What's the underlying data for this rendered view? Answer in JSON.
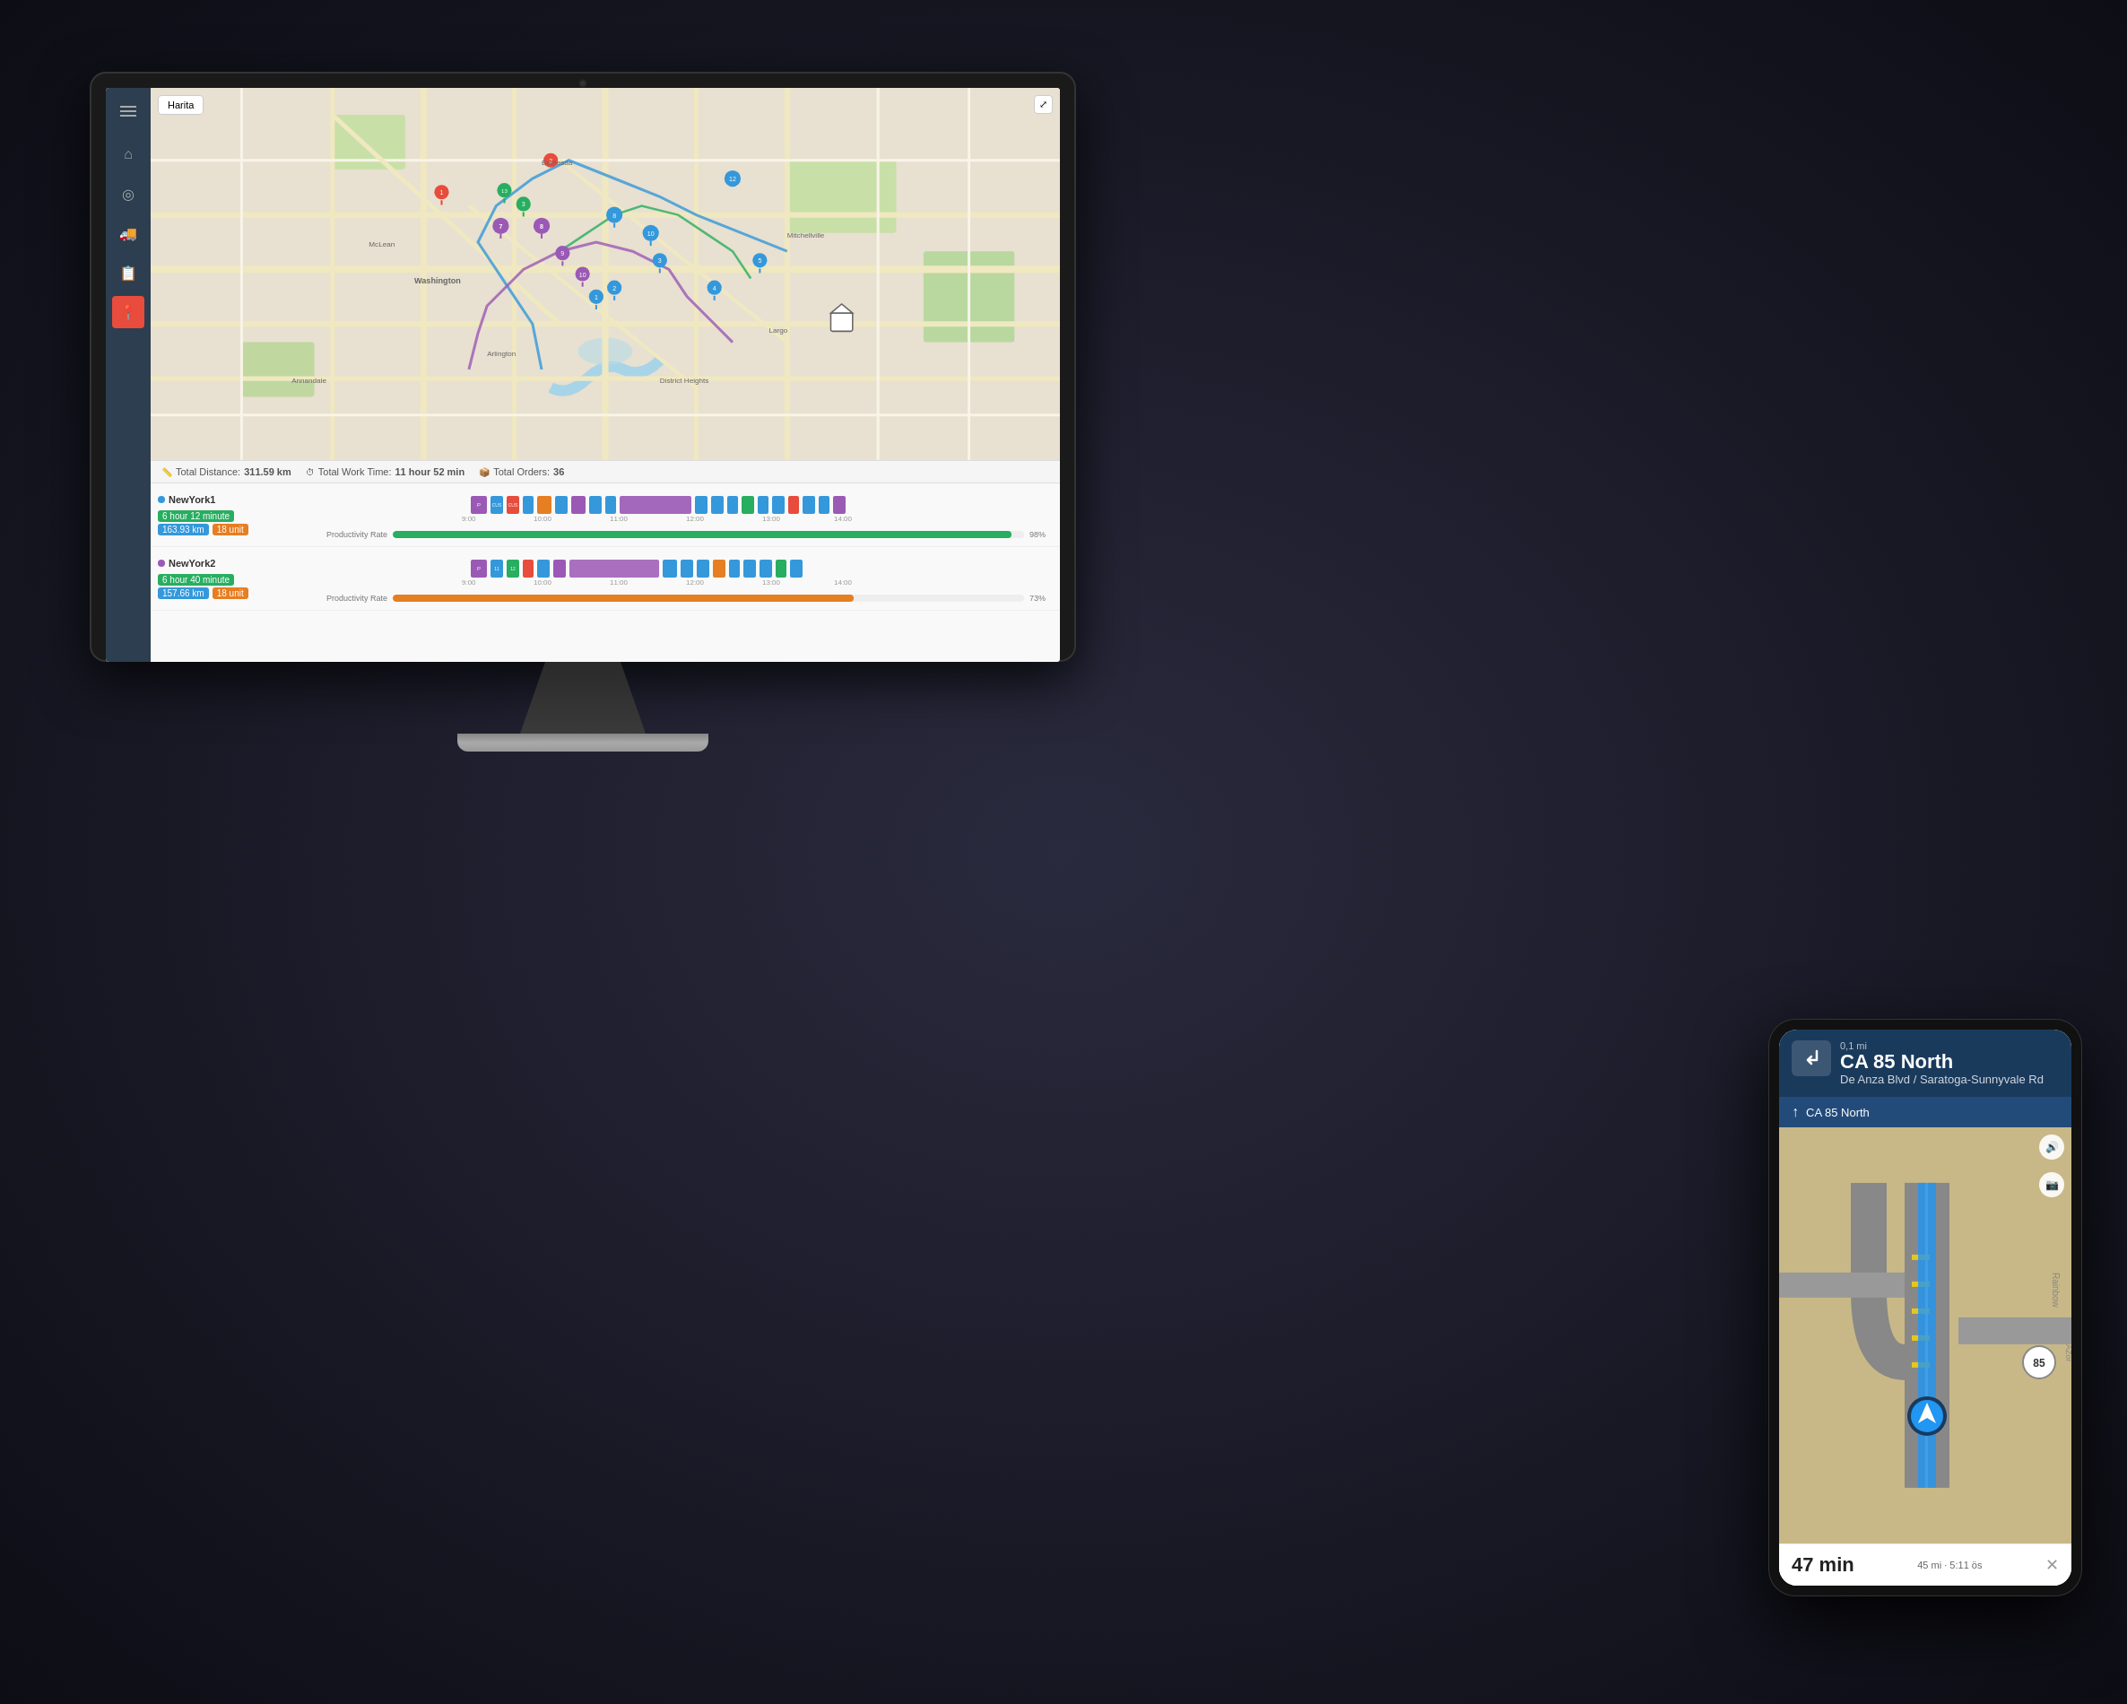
{
  "scene": {
    "bg_color": "#0d0d15"
  },
  "monitor": {
    "sidebar": {
      "menu_label": "☰",
      "items": [
        {
          "id": "home",
          "icon": "⌂",
          "active": false
        },
        {
          "id": "location",
          "icon": "◉",
          "active": false
        },
        {
          "id": "truck",
          "icon": "🚚",
          "active": false
        },
        {
          "id": "document",
          "icon": "📋",
          "active": false
        },
        {
          "id": "pin",
          "icon": "📍",
          "active": true
        }
      ]
    },
    "toolbar": {
      "map_label": "Harita",
      "expand_icon": "⤢"
    },
    "stats": {
      "distance_label": "Total Distance:",
      "distance_value": "311.59 km",
      "worktime_label": "Total Work Time:",
      "worktime_value": "11 hour 52 min",
      "orders_label": "Total Orders:",
      "orders_value": "36"
    },
    "routes": [
      {
        "id": "route1",
        "name": "NewYork1",
        "color": "#3498db",
        "time": "6 hour 12 minute",
        "km": "163.93 km",
        "units": "18 unit",
        "productivity": "98%",
        "productivity_color": "#27ae60"
      },
      {
        "id": "route2",
        "name": "NewYork2",
        "color": "#9b59b6",
        "time": "6 hour 40 minute",
        "km": "157.66 km",
        "units": "18 unit",
        "productivity": "73%",
        "productivity_color": "#e67e22"
      }
    ],
    "timeline": {
      "times": [
        "9:00",
        "10:00",
        "11:00",
        "12:00",
        "13:00",
        "14:00"
      ],
      "productivity_label": "Productivity Rate"
    }
  },
  "smartphone": {
    "nav_direction": "↰",
    "nav_title": "CA 85 North",
    "nav_subtitle": "De Anza Blvd / Saratoga-Sunnyvale Rd",
    "nav_distance": "0,1 mi",
    "next_instruction_icon": "↑",
    "next_instruction": "CA 85 North",
    "road_badge": "85",
    "volume_icon": "🔊",
    "camera_icon": "📷",
    "eta_value": "47 min",
    "eta_label": "min",
    "distance": "45 mi",
    "arrival": "5:11 ös",
    "close_icon": "✕"
  }
}
